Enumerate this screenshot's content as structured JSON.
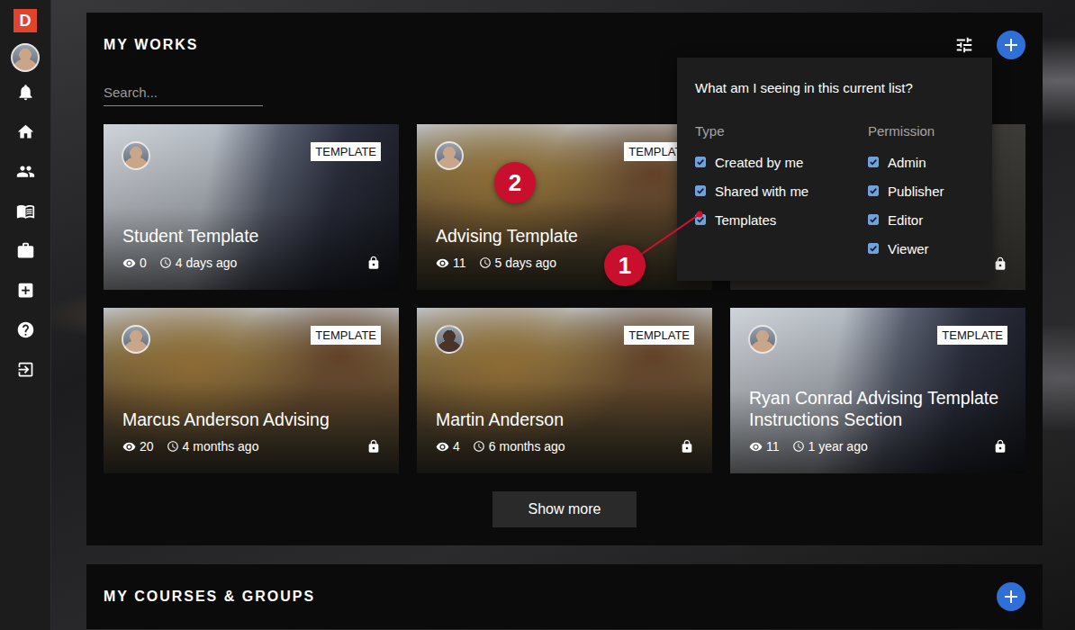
{
  "brand": {
    "logo": "D"
  },
  "works": {
    "title": "MY WORKS",
    "search": {
      "placeholder": "Search..."
    },
    "cards": [
      {
        "kind": "laptop",
        "title": "Student Template",
        "badge": "TEMPLATE",
        "views": "0",
        "time": "4 days ago",
        "color": "#c9a58a"
      },
      {
        "kind": "campus",
        "title": "Advising Template",
        "badge": "TEMPLATE",
        "views": "11",
        "time": "5 days ago",
        "color": "#c9a58a"
      },
      {
        "kind": "covered",
        "title": "",
        "badge": "",
        "views": "",
        "time": "",
        "color": "#c9a58a"
      },
      {
        "kind": "campus",
        "title": "Marcus Anderson Advising",
        "badge": "TEMPLATE",
        "views": "20",
        "time": "4 months ago",
        "color": "#c9a58a"
      },
      {
        "kind": "campus",
        "title": "Martin Anderson",
        "badge": "TEMPLATE",
        "views": "4",
        "time": "6 months ago",
        "color": "#4a3328"
      },
      {
        "kind": "laptop",
        "title": "Ryan Conrad Advising Template Instructions Section",
        "badge": "TEMPLATE",
        "views": "11",
        "time": "1 year ago",
        "color": "#c9a58a"
      }
    ],
    "show_more": "Show more"
  },
  "filter": {
    "title": "What am I seeing in this current list?",
    "groups": [
      {
        "label": "Type",
        "options": [
          {
            "label": "Created by me",
            "checked": true
          },
          {
            "label": "Shared with me",
            "checked": true
          },
          {
            "label": "Templates",
            "checked": true
          }
        ]
      },
      {
        "label": "Permission",
        "options": [
          {
            "label": "Admin",
            "checked": true
          },
          {
            "label": "Publisher",
            "checked": true
          },
          {
            "label": "Editor",
            "checked": true
          },
          {
            "label": "Viewer",
            "checked": true
          }
        ]
      }
    ]
  },
  "annotations": [
    {
      "label": "1"
    },
    {
      "label": "2"
    }
  ],
  "courses": {
    "title": "MY COURSES & GROUPS"
  }
}
